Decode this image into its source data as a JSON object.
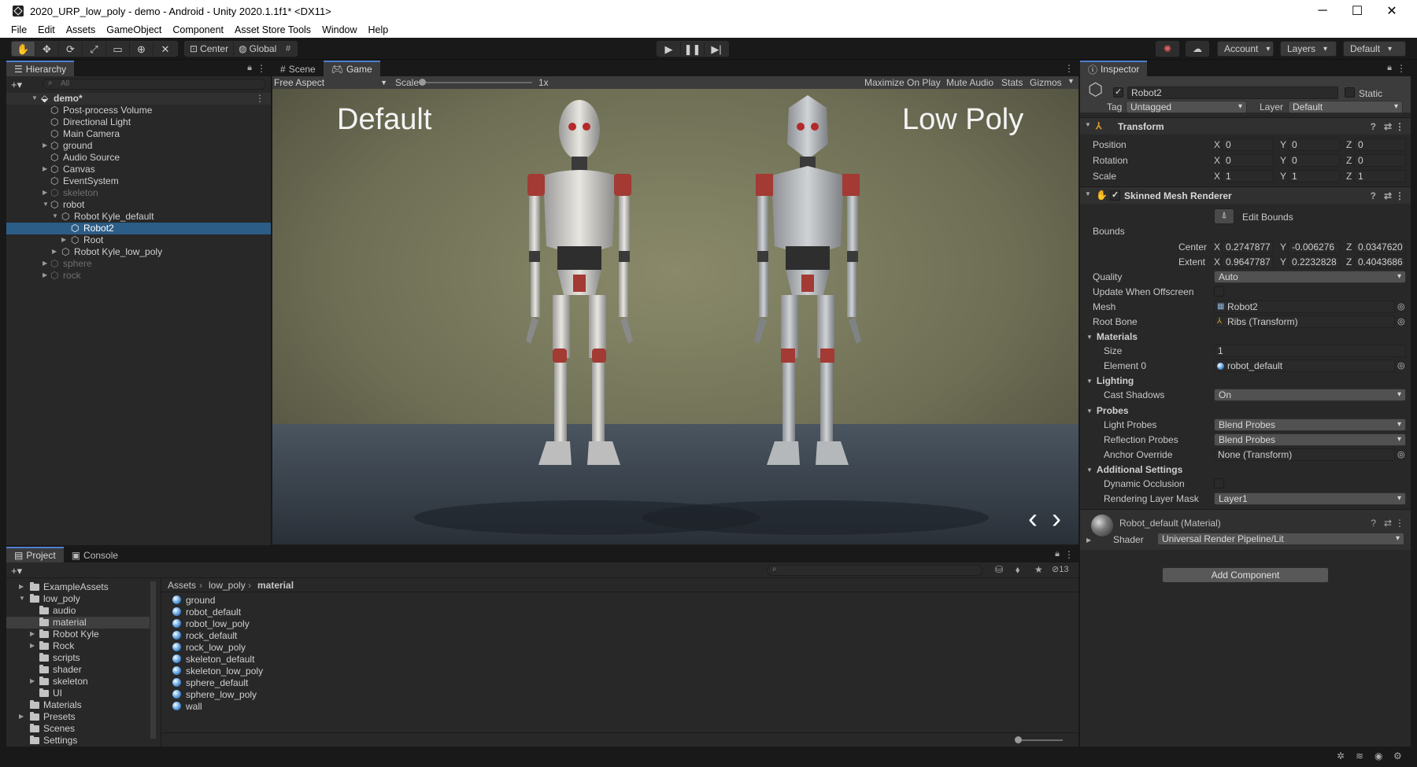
{
  "window": {
    "title": "2020_URP_low_poly - demo - Android - Unity 2020.1.1f1* <DX11>",
    "min": "─",
    "max": "☐",
    "close": "✕"
  },
  "menu": [
    "File",
    "Edit",
    "Assets",
    "GameObject",
    "Component",
    "Asset Store Tools",
    "Window",
    "Help"
  ],
  "toolbar": {
    "center": "Center",
    "global": "Global",
    "account": "Account",
    "layers": "Layers",
    "layout": "Default"
  },
  "hierarchy": {
    "tab": "Hierarchy",
    "search_placeholder": "All",
    "scene": "demo*",
    "items": [
      {
        "label": "Post-process Volume"
      },
      {
        "label": "Directional Light"
      },
      {
        "label": "Main Camera"
      },
      {
        "label": "ground"
      },
      {
        "label": "Audio Source"
      },
      {
        "label": "Canvas"
      },
      {
        "label": "EventSystem"
      },
      {
        "label": "skeleton"
      },
      {
        "label": "robot"
      },
      {
        "label": "Robot Kyle_default"
      },
      {
        "label": "Robot2"
      },
      {
        "label": "Root"
      },
      {
        "label": "Robot Kyle_low_poly"
      },
      {
        "label": "sphere"
      },
      {
        "label": "rock"
      }
    ]
  },
  "view": {
    "tabs": [
      "Scene",
      "Game"
    ],
    "aspect": "Free Aspect",
    "scale_label": "Scale",
    "scale_value": "1x",
    "scale_level": 0.0,
    "maximize": "Maximize On Play",
    "mute": "Mute Audio",
    "stats": "Stats",
    "gizmos": "Gizmos",
    "label_left": "Default",
    "label_right": "Low Poly",
    "prev": "‹",
    "next": "›"
  },
  "inspector": {
    "tab": "Inspector",
    "object_name": "Robot2",
    "static": "Static",
    "tag_label": "Tag",
    "tag_value": "Untagged",
    "layer_label": "Layer",
    "layer_value": "Default",
    "transform": {
      "title": "Transform",
      "rows": [
        {
          "label": "Position",
          "x": "0",
          "y": "0",
          "z": "0"
        },
        {
          "label": "Rotation",
          "x": "0",
          "y": "0",
          "z": "0"
        },
        {
          "label": "Scale",
          "x": "1",
          "y": "1",
          "z": "1"
        }
      ]
    },
    "smr": {
      "title": "Skinned Mesh Renderer",
      "edit_bounds": "Edit Bounds",
      "bounds": "Bounds",
      "center_label": "Center",
      "center": {
        "x": "0.2747877",
        "y": "-0.006276",
        "z": "0.0347620"
      },
      "extent_label": "Extent",
      "extent": {
        "x": "0.9647787",
        "y": "0.2232828",
        "z": "0.4043686"
      },
      "quality_label": "Quality",
      "quality": "Auto",
      "update_offscreen": "Update When Offscreen",
      "mesh_label": "Mesh",
      "mesh": "Robot2",
      "root_bone_label": "Root Bone",
      "root_bone": "Ribs (Transform)",
      "materials": "Materials",
      "size_label": "Size",
      "size": "1",
      "element0_label": "Element 0",
      "element0": "robot_default",
      "lighting": "Lighting",
      "cast_shadows_label": "Cast Shadows",
      "cast_shadows": "On",
      "probes": "Probes",
      "light_probes_label": "Light Probes",
      "light_probes": "Blend Probes",
      "reflection_probes_label": "Reflection Probes",
      "reflection_probes": "Blend Probes",
      "anchor_label": "Anchor Override",
      "anchor": "None (Transform)",
      "additional": "Additional Settings",
      "dynamic_occlusion": "Dynamic Occlusion",
      "rendering_layer_label": "Rendering Layer Mask",
      "rendering_layer": "Layer1"
    },
    "material": {
      "title": "Robot_default (Material)",
      "shader_label": "Shader",
      "shader": "Universal Render Pipeline/Lit"
    },
    "add_component": "Add Component"
  },
  "project": {
    "tabs": [
      "Project",
      "Console"
    ],
    "tree": [
      {
        "label": "ExampleAssets"
      },
      {
        "label": "low_poly"
      },
      {
        "label": "audio"
      },
      {
        "label": "material"
      },
      {
        "label": "Robot Kyle"
      },
      {
        "label": "Rock"
      },
      {
        "label": "scripts"
      },
      {
        "label": "shader"
      },
      {
        "label": "skeleton"
      },
      {
        "label": "UI"
      },
      {
        "label": "Materials"
      },
      {
        "label": "Presets"
      },
      {
        "label": "Scenes"
      },
      {
        "label": "Settings"
      }
    ],
    "breadcrumb": [
      "Assets",
      "low_poly",
      "material"
    ],
    "hidden_count": "13",
    "files": [
      "ground",
      "robot_default",
      "robot_low_poly",
      "rock_default",
      "rock_low_poly",
      "skeleton_default",
      "skeleton_low_poly",
      "sphere_default",
      "sphere_low_poly",
      "wall"
    ]
  }
}
